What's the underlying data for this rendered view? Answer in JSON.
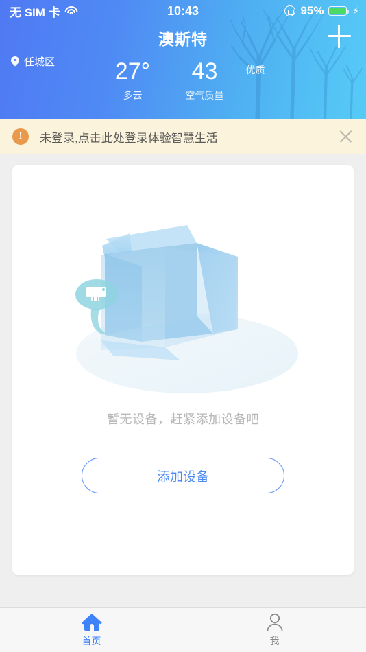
{
  "statusbar": {
    "carrier": "无 SIM 卡",
    "wifi_icon": "wifi-icon",
    "time": "10:43",
    "rotation_lock_icon": "rotation-lock-icon",
    "battery_percent": "95%",
    "battery_icon": "battery-icon",
    "charging_icon": "⚡",
    "battery_color": "#4cd964"
  },
  "header": {
    "title": "澳斯特",
    "add_icon": "plus-icon",
    "location_icon": "location-pin-icon",
    "location": "任城区",
    "temperature": "27°",
    "condition": "多云",
    "aqi_value": "43",
    "aqi_label": "空气质量",
    "aqi_quality": "优质",
    "gradient_from": "#4f79f3",
    "gradient_to": "#56cbf6"
  },
  "notice": {
    "icon": "!",
    "icon_name": "warning-icon",
    "text": "未登录,点击此处登录体验智慧生活",
    "close_icon": "close-icon",
    "background": "#fbf3dc",
    "icon_color": "#e8994b"
  },
  "card": {
    "illustration": "empty-box-illustration",
    "empty_text": "暂无设备，赶紧添加设备吧",
    "add_device_label": "添加设备",
    "accent_color": "#4c8af6"
  },
  "tabbar": {
    "items": [
      {
        "label": "首页",
        "icon": "home-icon",
        "active": true
      },
      {
        "label": "我",
        "icon": "person-icon",
        "active": false
      }
    ],
    "active_color": "#3f83f8",
    "inactive_color": "#8a8a8a"
  }
}
